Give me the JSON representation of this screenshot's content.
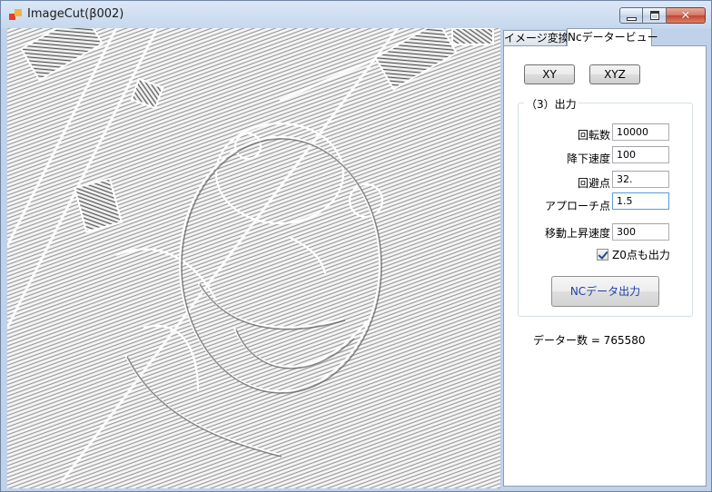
{
  "window": {
    "title": "ImageCut(β002)"
  },
  "tabs": [
    {
      "label": "イメージ変換",
      "active": false
    },
    {
      "label": "Ncデータービュー",
      "active": true
    }
  ],
  "panel": {
    "xy_button": "XY",
    "xyz_button": "XYZ",
    "output_group": {
      "title": "（3）出力",
      "fields": [
        {
          "label": "回転数",
          "value": "10000"
        },
        {
          "label": "降下速度",
          "value": "100"
        },
        {
          "label": "回避点",
          "value": "32."
        },
        {
          "label": "アプローチ点",
          "value": "1.5"
        },
        {
          "label": "移動上昇速度",
          "value": "300"
        }
      ],
      "z0_checkbox": {
        "label": "Z0点も出力",
        "checked": true
      },
      "nc_output_button": "NCデータ出力"
    },
    "data_count_text": "データー数 = 765580"
  },
  "colors": {
    "titlebar": "#c9d9ec",
    "nc_button_text": "#1a3ea8",
    "close_button": "#c4452d"
  }
}
